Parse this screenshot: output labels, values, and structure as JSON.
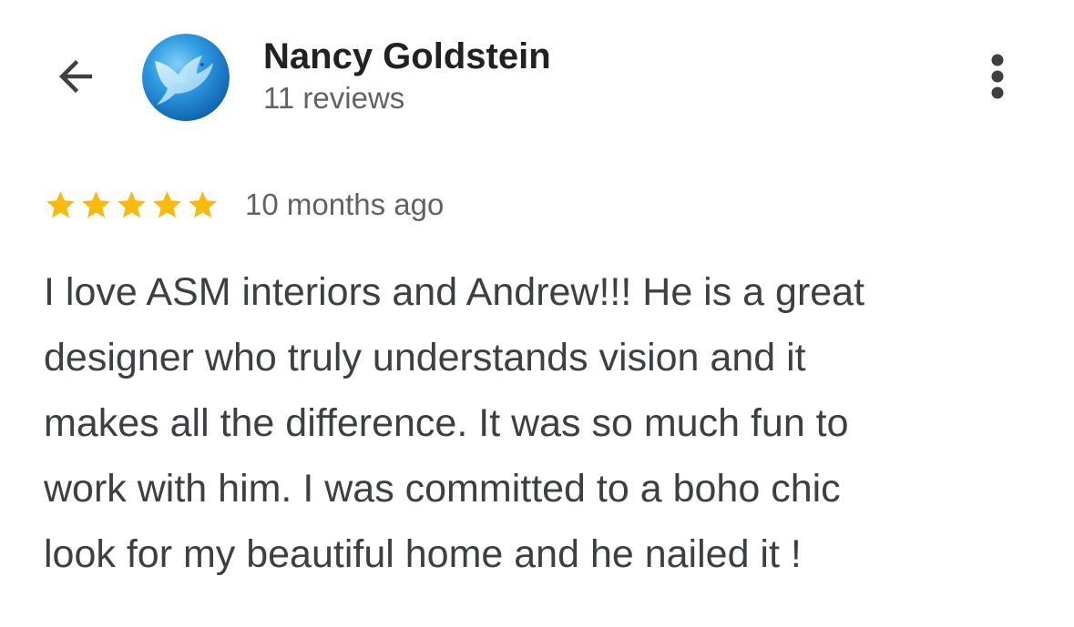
{
  "header": {
    "back_icon": "arrow-back-icon",
    "avatar_icon": "dove-avatar",
    "author_name": "Nancy Goldstein",
    "review_count": "11 reviews",
    "more_icon": "more-vert-icon"
  },
  "review": {
    "rating": 5,
    "rating_max": 5,
    "star_color": "#f8bb0c",
    "timestamp": "10 months ago",
    "text": "I love ASM interiors and Andrew!!! He is a great\ndesigner who truly understands vision and it\nmakes all the difference. It was so much fun to\nwork with him. I was committed to a boho chic\nlook for my beautiful home and he nailed it !"
  },
  "colors": {
    "text_primary": "#202124",
    "text_secondary": "#5f6368",
    "body_text": "#3c4043",
    "icon": "#3c4043",
    "avatar_blue": "#2a8bd6"
  }
}
